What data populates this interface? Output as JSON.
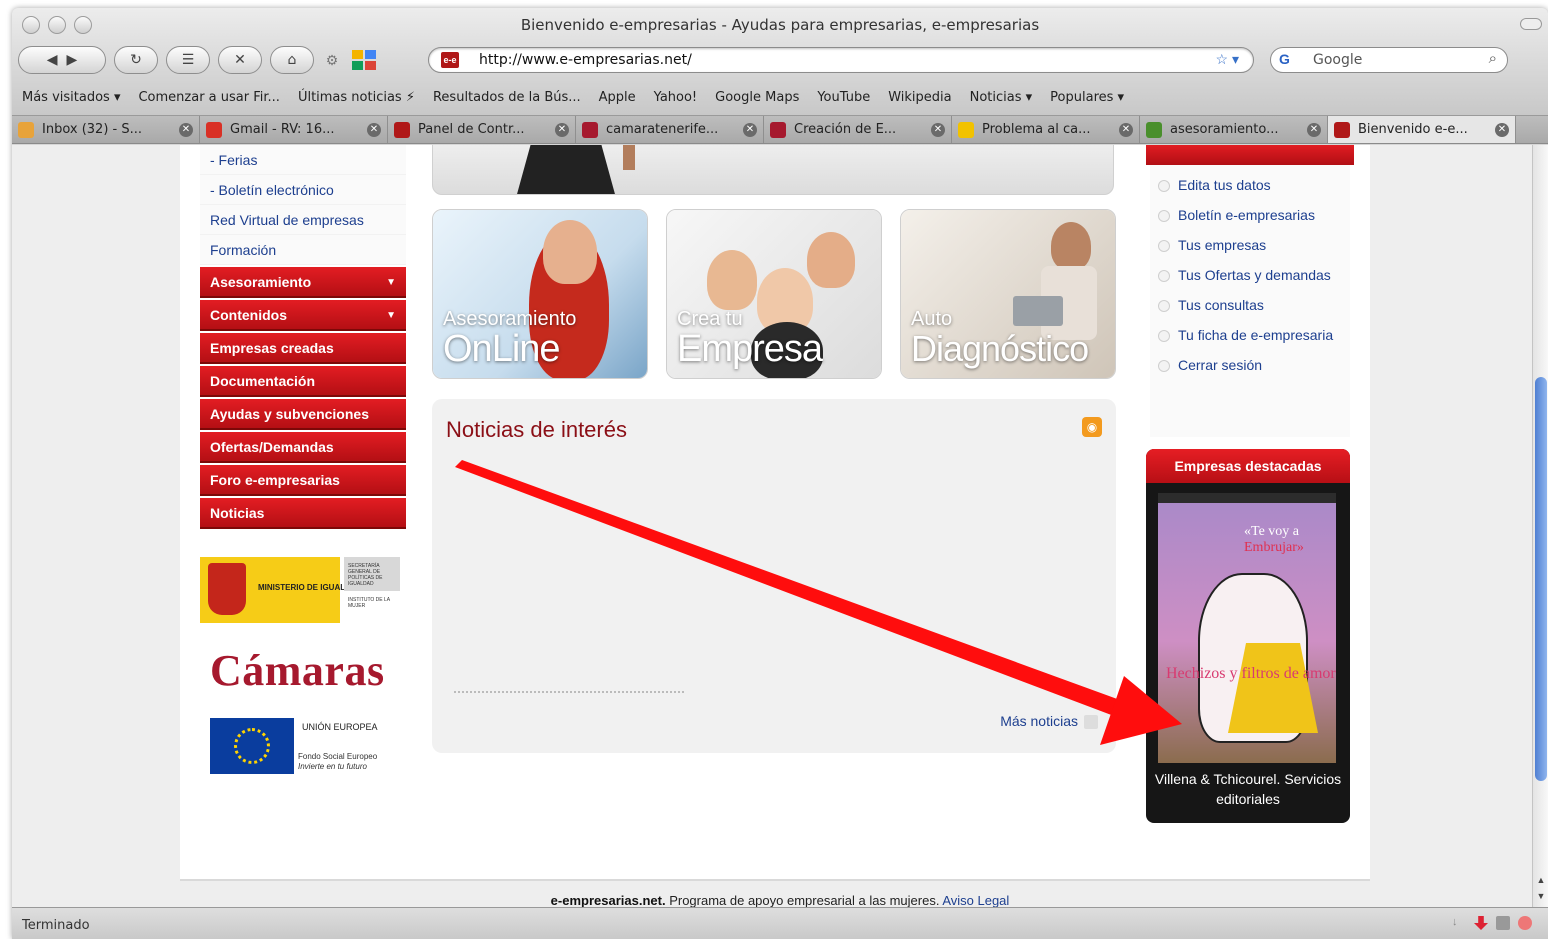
{
  "window": {
    "title": "Bienvenido e-empresarias - Ayudas para empresarias, e-empresarias"
  },
  "toolbar": {
    "url": "http://www.e-empresarias.net/",
    "favicon_text": "e-e",
    "search_engine": "G",
    "search_placeholder": "Google"
  },
  "bookmarks": [
    "Más visitados ▾",
    "Comenzar a usar Fir...",
    "Últimas noticias ⚡",
    "Resultados de la Bús...",
    "Apple",
    "Yahoo!",
    "Google Maps",
    "YouTube",
    "Wikipedia",
    "Noticias ▾",
    "Populares ▾"
  ],
  "tabs": [
    {
      "label": "Inbox (32) - S...",
      "color": "#e8a33a"
    },
    {
      "label": "Gmail - RV: 16...",
      "color": "#d93025"
    },
    {
      "label": "Panel de Contr...",
      "color": "#b01818"
    },
    {
      "label": "camaratenerife...",
      "color": "#a6192e"
    },
    {
      "label": "Creación de E...",
      "color": "#a6192e"
    },
    {
      "label": "Problema al ca...",
      "color": "#f2c200"
    },
    {
      "label": "asesoramiento...",
      "color": "#4a8f2c"
    },
    {
      "label": "Bienvenido e-e...",
      "color": "#b01818"
    }
  ],
  "left_nav": {
    "sub_items": [
      "- Ferias",
      "- Boletín electrónico",
      "Red Virtual de empresas",
      "Formación"
    ],
    "red_items": [
      {
        "label": "Asesoramiento",
        "caret": "▼"
      },
      {
        "label": "Contenidos",
        "caret": "▼"
      },
      {
        "label": "Empresas creadas",
        "caret": ""
      },
      {
        "label": "Documentación",
        "caret": ""
      },
      {
        "label": "Ayudas y subvenciones",
        "caret": ""
      },
      {
        "label": "Ofertas/Demandas",
        "caret": ""
      },
      {
        "label": "Foro e-empresarias",
        "caret": ""
      },
      {
        "label": "Noticias",
        "caret": ""
      }
    ]
  },
  "logos": {
    "ministerio": "MINISTERIO DE IGUALDAD",
    "secretaria": "SECRETARÍA GENERAL DE POLÍTICAS DE IGUALDAD",
    "instituto": "INSTITUTO DE LA MUJER",
    "camaras": "Cámaras",
    "ue_title": "UNIÓN EUROPEA",
    "ue_fund": "Fondo Social Europeo",
    "ue_motto": "Invierte en tu futuro"
  },
  "cards": [
    {
      "small": "Asesoramiento",
      "big": "OnLine"
    },
    {
      "small": "Crea tu",
      "big": "Empresa"
    },
    {
      "small": "Auto",
      "big": "Diagnóstico"
    }
  ],
  "news": {
    "title": "Noticias de interés",
    "more": "Más noticias"
  },
  "personal_menu": {
    "items": [
      "Edita tus datos",
      "Boletín e-empresarias",
      "Tus empresas",
      "Tus Ofertas y demandas",
      "Tus consultas",
      "Tu ficha de e-empresaria",
      "Cerrar sesión"
    ]
  },
  "featured": {
    "title": "Empresas destacadas",
    "book_title_1": "«Te voy a",
    "book_title_2": "Embrujar»",
    "book_hechizos": "Hechizos y filtros de amor",
    "caption": "Villena & Tchicourel. Servicios editoriales"
  },
  "footer": {
    "brand": "e-empresarias.net.",
    "text": " Programa de apoyo empresarial a las mujeres. ",
    "link": "Aviso Legal"
  },
  "status": {
    "text": "Terminado"
  },
  "colors": {
    "brand_red": "#c8141b",
    "link_blue": "#1d3f8f",
    "annotation_arrow": "#ff0000"
  }
}
